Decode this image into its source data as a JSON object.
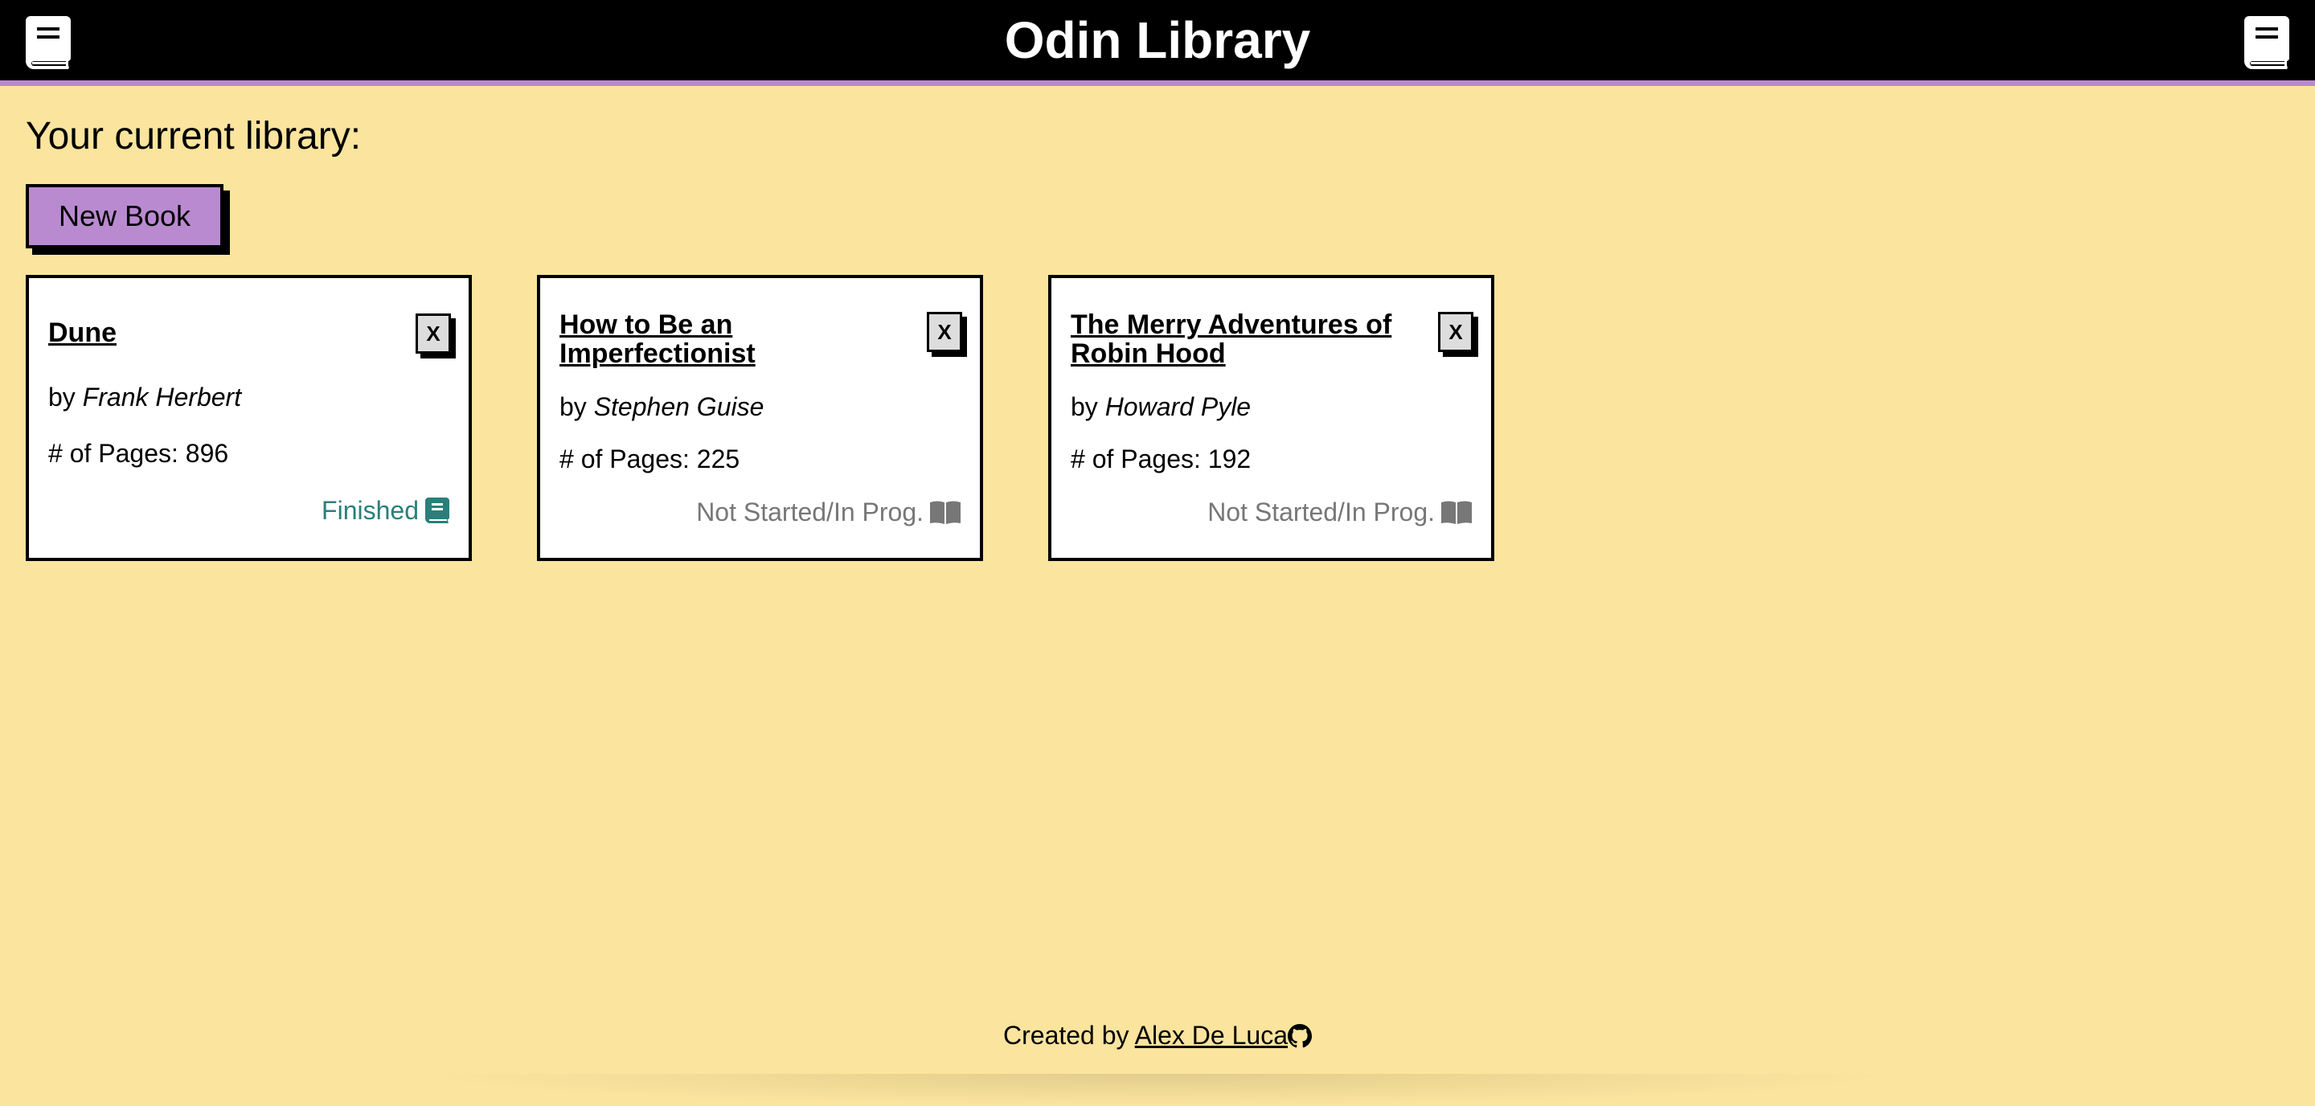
{
  "header": {
    "title": "Odin Library",
    "left_icon": "book-icon",
    "right_icon": "book-icon"
  },
  "main": {
    "heading": "Your current library:",
    "new_book_label": "New Book"
  },
  "books": [
    {
      "title": "Dune",
      "author_prefix": "by",
      "author": "Frank Herbert",
      "pages_text": "# of Pages: 896",
      "status": "Finished",
      "status_icon": "closed-book-icon",
      "close_label": "X"
    },
    {
      "title": "How to Be an Imperfectionist",
      "author_prefix": "by",
      "author": "Stephen Guise",
      "pages_text": "# of Pages: 225",
      "status": "Not Started/In Prog.",
      "status_icon": "open-book-icon",
      "close_label": "X"
    },
    {
      "title": "The Merry Adventures of Robin Hood",
      "author_prefix": "by",
      "author": "Howard Pyle",
      "pages_text": "# of Pages: 192",
      "status": "Not Started/In Prog.",
      "status_icon": "open-book-icon",
      "close_label": "X"
    }
  ],
  "footer": {
    "prefix": "Created by",
    "author_link": "Alex De Luca",
    "icon": "github-icon"
  },
  "colors": {
    "background": "#fbe49d",
    "header": "#000000",
    "accent": "#b98ad0",
    "finished": "#2a7f7a",
    "not_started": "#777777"
  }
}
